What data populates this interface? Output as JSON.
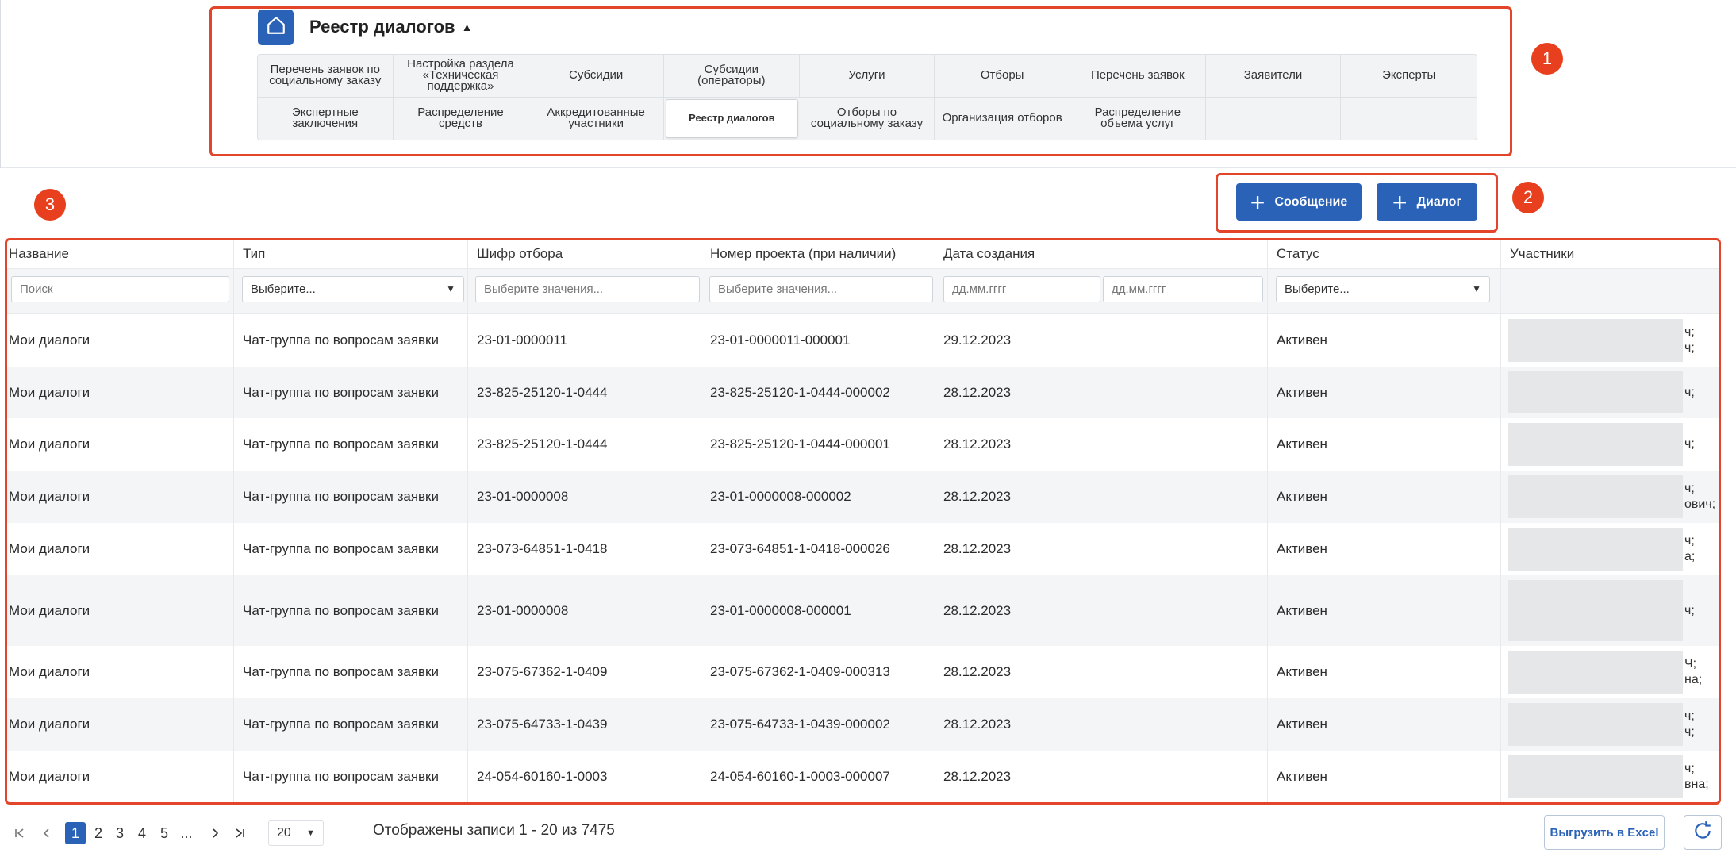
{
  "nav": {
    "title": "Реестр диалогов",
    "tabs_row1": [
      "Перечень заявок по социальному заказу",
      "Настройка раздела «Техническая поддержка»",
      "Субсидии",
      "Субсидии (операторы)",
      "Услуги",
      "Отборы",
      "Перечень заявок",
      "Заявители",
      "Эксперты"
    ],
    "tabs_row2": [
      "Экспертные заключения",
      "Распределение средств",
      "Аккредитованные участники",
      "Реестр диалогов",
      "Отборы по социальному заказу",
      "Организация отборов",
      "Распределение объема услуг"
    ],
    "active_tab": "Реестр диалогов"
  },
  "actions": {
    "message_label": "Сообщение",
    "dialog_label": "Диалог"
  },
  "annotations": [
    "1",
    "2",
    "3"
  ],
  "table": {
    "headers": [
      "Название",
      "Тип",
      "Шифр отбора",
      "Номер проекта (при наличии)",
      "Дата создания",
      "Статус",
      "Участники"
    ],
    "filters": {
      "name_placeholder": "Поиск",
      "type_placeholder": "Выберите...",
      "code_placeholder": "Выберите значения...",
      "project_placeholder": "Выберите значения...",
      "date_from_placeholder": "дд.мм.гггг",
      "date_to_placeholder": "дд.мм.гггг",
      "status_placeholder": "Выберите..."
    },
    "rows": [
      {
        "name": "Мои диалоги",
        "type": "Чат-группа по вопросам заявки",
        "code": "23-01-0000011",
        "project": "23-01-0000011-000001",
        "date": "29.12.2023",
        "status": "Активен",
        "participants": [
          "ч;",
          "ч;"
        ]
      },
      {
        "name": "Мои диалоги",
        "type": "Чат-группа по вопросам заявки",
        "code": "23-825-25120-1-0444",
        "project": "23-825-25120-1-0444-000002",
        "date": "28.12.2023",
        "status": "Активен",
        "participants": [
          "ч;"
        ]
      },
      {
        "name": "Мои диалоги",
        "type": "Чат-группа по вопросам заявки",
        "code": "23-825-25120-1-0444",
        "project": "23-825-25120-1-0444-000001",
        "date": "28.12.2023",
        "status": "Активен",
        "participants": [
          "ч;"
        ]
      },
      {
        "name": "Мои диалоги",
        "type": "Чат-группа по вопросам заявки",
        "code": "23-01-0000008",
        "project": "23-01-0000008-000002",
        "date": "28.12.2023",
        "status": "Активен",
        "participants": [
          "ч;",
          "ович;"
        ]
      },
      {
        "name": "Мои диалоги",
        "type": "Чат-группа по вопросам заявки",
        "code": "23-073-64851-1-0418",
        "project": "23-073-64851-1-0418-000026",
        "date": "28.12.2023",
        "status": "Активен",
        "participants": [
          "ч;",
          "а;"
        ]
      },
      {
        "name": "Мои диалоги",
        "type": "Чат-группа по вопросам заявки",
        "code": "23-01-0000008",
        "project": "23-01-0000008-000001",
        "date": "28.12.2023",
        "status": "Активен",
        "participants": [
          "ч;"
        ]
      },
      {
        "name": "Мои диалоги",
        "type": "Чат-группа по вопросам заявки",
        "code": "23-075-67362-1-0409",
        "project": "23-075-67362-1-0409-000313",
        "date": "28.12.2023",
        "status": "Активен",
        "participants": [
          "Ч;",
          "на;"
        ]
      },
      {
        "name": "Мои диалоги",
        "type": "Чат-группа по вопросам заявки",
        "code": "23-075-64733-1-0439",
        "project": "23-075-64733-1-0439-000002",
        "date": "28.12.2023",
        "status": "Активен",
        "participants": [
          "ч;",
          "ч;"
        ]
      },
      {
        "name": "Мои диалоги",
        "type": "Чат-группа по вопросам заявки",
        "code": "24-054-60160-1-0003",
        "project": "24-054-60160-1-0003-000007",
        "date": "28.12.2023",
        "status": "Активен",
        "participants": [
          "ч;",
          "вна;"
        ]
      }
    ]
  },
  "pagination": {
    "pages": [
      "1",
      "2",
      "3",
      "4",
      "5",
      "..."
    ],
    "current": "1",
    "page_size": "20",
    "records_text": "Отображены записи 1 - 20 из 7475",
    "excel_label": "Выгрузить в Excel"
  },
  "colors": {
    "primary": "#2a62b8",
    "annotation": "#e2452a",
    "row_alt": "#f4f5f7"
  }
}
